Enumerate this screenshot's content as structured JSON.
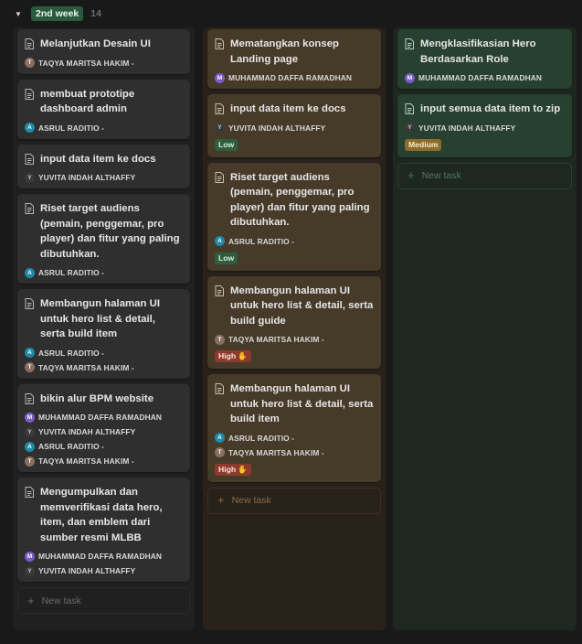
{
  "group": {
    "label": "2nd week",
    "count": "14",
    "accent": "#2b593f"
  },
  "columns": [
    {
      "cards": [
        {
          "title": "Melanjutkan Desain UI",
          "people": [
            {
              "initial": "T",
              "name": "TAQYA MARITSA HAKIM -"
            }
          ]
        },
        {
          "title": "membuat prototipe dashboard admin",
          "people": [
            {
              "initial": "A",
              "name": "ASRUL RADITIO -"
            }
          ]
        },
        {
          "title": "input data item ke docs",
          "people": [
            {
              "initial": "Y",
              "name": "YUVITA INDAH ALTHAFFY"
            }
          ]
        },
        {
          "title": "Riset target audiens (pemain, penggemar, pro player) dan fitur yang paling dibutuhkan.",
          "people": [
            {
              "initial": "A",
              "name": "ASRUL RADITIO -"
            }
          ]
        },
        {
          "title": "Membangun halaman UI untuk hero list & detail, serta build item",
          "people": [
            {
              "initial": "A",
              "name": "ASRUL RADITIO -"
            },
            {
              "initial": "T",
              "name": "TAQYA MARITSA HAKIM -"
            }
          ]
        },
        {
          "title": "bikin alur BPM website",
          "people": [
            {
              "initial": "M",
              "name": "MUHAMMAD DAFFA RAMADHAN"
            },
            {
              "initial": "Y",
              "name": "YUVITA INDAH ALTHAFFY"
            },
            {
              "initial": "A",
              "name": "ASRUL RADITIO -"
            },
            {
              "initial": "T",
              "name": "TAQYA MARITSA HAKIM -"
            }
          ]
        },
        {
          "title": "Mengumpulkan dan memverifikasi data hero, item, dan emblem dari sumber resmi MLBB",
          "people": [
            {
              "initial": "M",
              "name": "MUHAMMAD DAFFA RAMADHAN"
            },
            {
              "initial": "Y",
              "name": "YUVITA INDAH ALTHAFFY"
            }
          ]
        }
      ],
      "new_task": "New task"
    },
    {
      "cards": [
        {
          "title": "Mematangkan konsep Landing page",
          "people": [
            {
              "initial": "M",
              "name": "MUHAMMAD DAFFA RAMADHAN"
            }
          ]
        },
        {
          "title": "input data item ke docs",
          "people": [
            {
              "initial": "Y",
              "name": "YUVITA INDAH ALTHAFFY"
            }
          ],
          "tag": "Low"
        },
        {
          "title": "Riset target audiens (pemain, penggemar, pro player) dan fitur yang paling dibutuhkan.",
          "people": [
            {
              "initial": "A",
              "name": "ASRUL RADITIO -"
            }
          ],
          "tag": "Low"
        },
        {
          "title": "Membangun halaman UI untuk hero list & detail, serta build guide",
          "people": [
            {
              "initial": "T",
              "name": "TAQYA MARITSA HAKIM -"
            }
          ],
          "tag": "High"
        },
        {
          "title": "Membangun halaman UI untuk hero list & detail, serta build item",
          "people": [
            {
              "initial": "A",
              "name": "ASRUL RADITIO -"
            },
            {
              "initial": "T",
              "name": "TAQYA MARITSA HAKIM -"
            }
          ],
          "tag": "High"
        }
      ],
      "new_task": "New task"
    },
    {
      "cards": [
        {
          "title": "Mengklasifikasian Hero Berdasarkan Role",
          "people": [
            {
              "initial": "M",
              "name": "MUHAMMAD DAFFA RAMADHAN"
            }
          ]
        },
        {
          "title": "input semua data item to zip",
          "people": [
            {
              "initial": "Y",
              "name": "YUVITA INDAH ALTHAFFY"
            }
          ],
          "tag": "Medium"
        }
      ],
      "new_task": "New task"
    }
  ],
  "tag_colors": {
    "Low": "#2f5e3f",
    "High": "#8d3a2e",
    "Medium": "#8a6d2c"
  },
  "icons": {
    "toggle": "triangle-down-icon",
    "page": "page-icon",
    "high_tag": "raised-hand-icon",
    "new": "plus-icon"
  }
}
